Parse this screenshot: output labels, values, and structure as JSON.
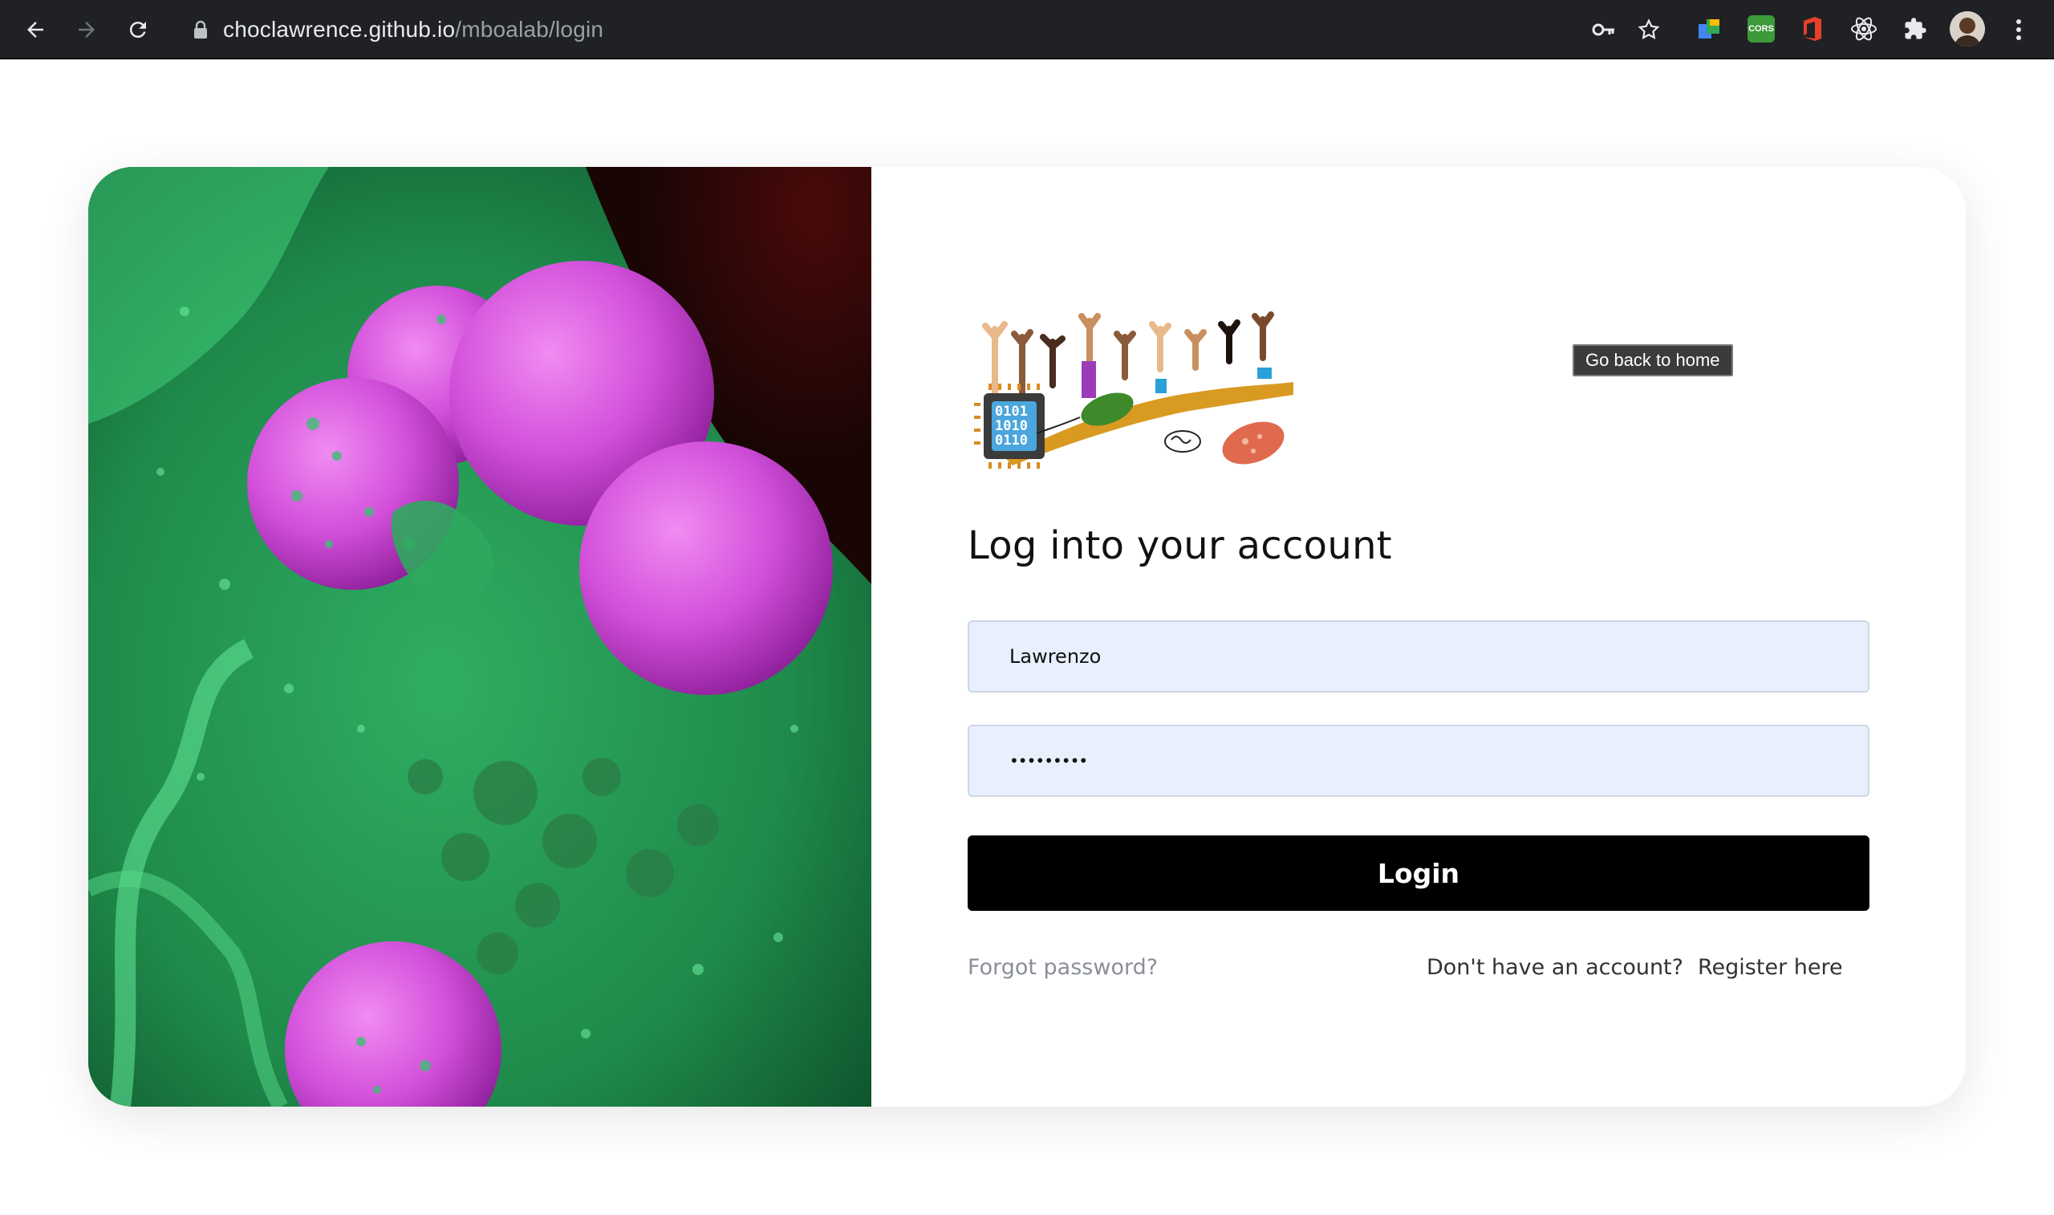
{
  "browser": {
    "url_host": "choclawrence.github.io",
    "url_path": "/mboalab/login",
    "icons": [
      "back-icon",
      "forward-icon",
      "reload-icon",
      "lock-icon",
      "key-icon",
      "star-icon",
      "extension-cors-icon",
      "office-icon",
      "react-icon",
      "puzzle-icon",
      "profile-avatar",
      "menu-icon"
    ],
    "cors_label": "CORS"
  },
  "login": {
    "heading": "Log into your account",
    "username_value": "Lawrenzo",
    "password_value": "•••••••••",
    "login_button": "Login",
    "forgot_password": "Forgot password?",
    "no_account": "Don't have an account?",
    "register": "Register here",
    "logo_digits": [
      "0101",
      "1010",
      "0110"
    ]
  },
  "tooltip": {
    "text": "Go back to home"
  },
  "colors": {
    "button_bg": "#000000",
    "field_bg": "#e8f0fe",
    "muted_link": "#8a8f98",
    "cell_green": "#2dbd6e",
    "bacteria_pink": "#d14bd8"
  }
}
